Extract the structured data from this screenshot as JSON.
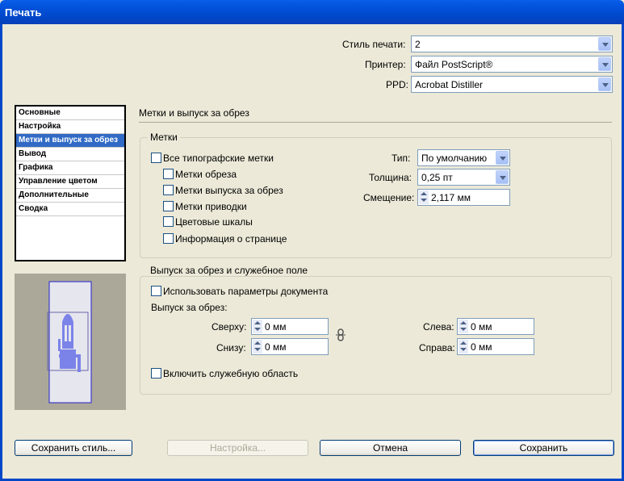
{
  "window": {
    "title": "Печать"
  },
  "top": {
    "style_label": "Стиль печати:",
    "style_value": "2",
    "printer_label": "Принтер:",
    "printer_value": "Файл PostScript®",
    "ppd_label": "PPD:",
    "ppd_value": "Acrobat Distiller"
  },
  "sidebar": {
    "items": [
      {
        "label": "Основные"
      },
      {
        "label": "Настройка"
      },
      {
        "label": "Метки и выпуск за обрез",
        "selected": true
      },
      {
        "label": "Вывод"
      },
      {
        "label": "Графика"
      },
      {
        "label": "Управление цветом"
      },
      {
        "label": "Дополнительные"
      },
      {
        "label": "Сводка"
      }
    ]
  },
  "panel": {
    "title": "Метки и выпуск за обрез",
    "marks": {
      "title": "Метки",
      "all_marks": "Все типографские метки",
      "crop_marks": "Метки обреза",
      "bleed_marks": "Метки выпуска за обрез",
      "registration_marks": "Метки приводки",
      "color_bars": "Цветовые шкалы",
      "page_info": "Информация о странице",
      "type_label": "Тип:",
      "type_value": "По умолчанию",
      "weight_label": "Толщина:",
      "weight_value": "0,25 пт",
      "offset_label": "Смещение:",
      "offset_value": "2,117 мм"
    },
    "bleed": {
      "title": "Выпуск за обрез и служебное поле",
      "use_doc": "Использовать параметры документа",
      "bleed_label": "Выпуск за обрез:",
      "top_label": "Сверху:",
      "top_value": "0 мм",
      "bottom_label": "Снизу:",
      "bottom_value": "0 мм",
      "left_label": "Слева:",
      "left_value": "0 мм",
      "right_label": "Справа:",
      "right_value": "0 мм",
      "slug": "Включить служебную область"
    }
  },
  "buttons": {
    "save_style": "Сохранить стиль...",
    "setup": "Настройка...",
    "cancel": "Отмена",
    "save": "Сохранить"
  },
  "colors": {
    "title_bar": "#0047c9",
    "selection": "#316ac5",
    "dialog_bg": "#ece9d8",
    "preview_bg": "#aca899",
    "preview_page": "#e6e6ee",
    "preview_accent": "#7b83e8"
  },
  "icons": {
    "chain": "chain-link-icon"
  }
}
